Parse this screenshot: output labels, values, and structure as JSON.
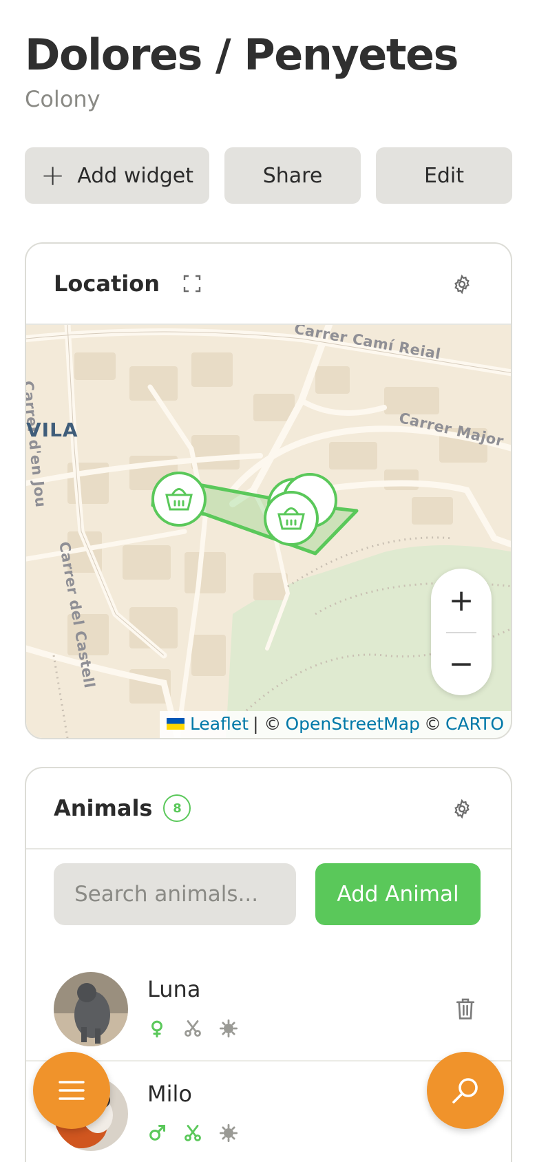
{
  "header": {
    "title": "Dolores / Penyetes",
    "subtitle": "Colony"
  },
  "toolbar": {
    "add_widget_label": "Add widget",
    "share_label": "Share",
    "edit_label": "Edit"
  },
  "location_widget": {
    "title": "Location",
    "map": {
      "street_labels": [
        "Carrer Camí Reial",
        "Carrer Major",
        "Carrer d'en Jou",
        "Carrer del Castell"
      ],
      "place_label": "VILA",
      "zoom_in": "+",
      "zoom_out": "−",
      "attribution": {
        "leaflet": "Leaflet",
        "sep": "| ©",
        "osm": "OpenStreetMap",
        "copy": "©",
        "carto": "CARTO"
      },
      "marker_color": "#5ac85a",
      "marker_icon": "basket-icon"
    }
  },
  "animals_widget": {
    "title": "Animals",
    "count": "8",
    "search_placeholder": "Search animals...",
    "add_button_label": "Add Animal",
    "items": [
      {
        "name": "Luna",
        "sex": "female",
        "sterilized": false,
        "icons": [
          "female-icon",
          "scissors-icon",
          "virus-icon"
        ]
      },
      {
        "name": "Milo",
        "sex": "male",
        "sterilized": true,
        "icons": [
          "male-icon",
          "scissors-icon",
          "virus-icon"
        ]
      }
    ]
  },
  "colors": {
    "accent": "#5ac85a",
    "fab": "#f0932b",
    "button_bg": "#e3e2de"
  }
}
